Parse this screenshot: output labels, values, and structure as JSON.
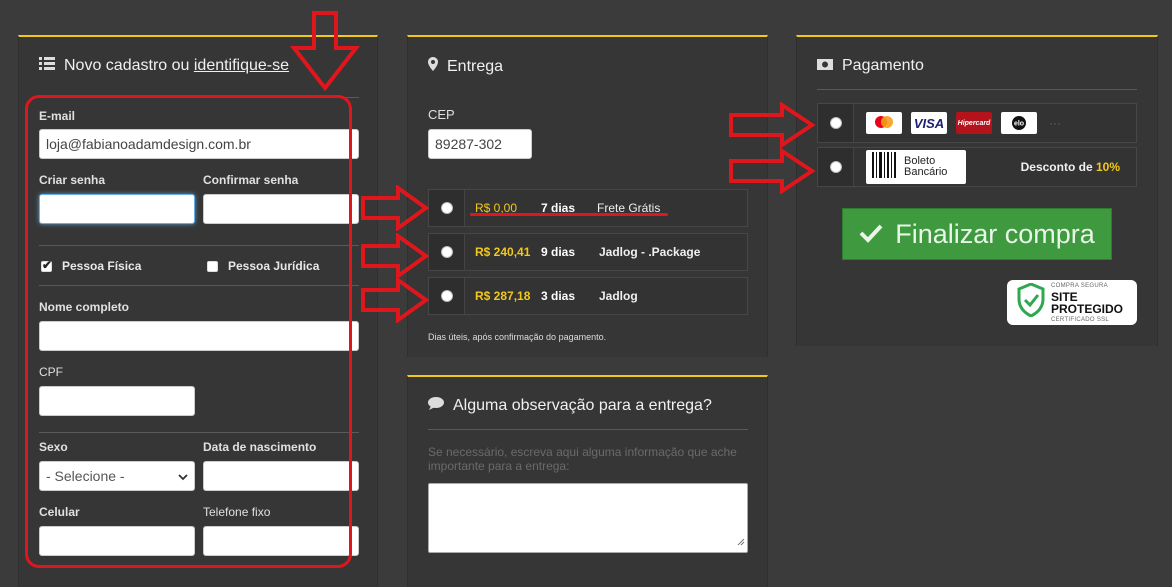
{
  "cadastro": {
    "title_prefix": "Novo cadastro ou ",
    "title_link": "identifique-se",
    "email_label": "E-mail",
    "email_value": "loja@fabianoadamdesign.com.br",
    "senha_label": "Criar senha",
    "confirmar_label": "Confirmar senha",
    "pessoa_fisica": "Pessoa Física",
    "pessoa_juridica": "Pessoa Jurídica",
    "nome_label": "Nome completo",
    "cpf_label": "CPF",
    "sexo_label": "Sexo",
    "sexo_value": "- Selecione -",
    "nascimento_label": "Data de nascimento",
    "celular_label": "Celular",
    "telefone_label": "Telefone fixo"
  },
  "entrega": {
    "title": "Entrega",
    "cep_label": "CEP",
    "cep_value": "89287-302",
    "options": [
      {
        "price": "R$ 0,00",
        "days": "7 dias",
        "carrier": "Frete Grátis"
      },
      {
        "price": "R$ 240,41",
        "days": "9 dias",
        "carrier": "Jadlog - .Package"
      },
      {
        "price": "R$ 287,18",
        "days": "3 dias",
        "carrier": "Jadlog"
      }
    ],
    "note": "Dias úteis, após confirmação do pagamento."
  },
  "observacao": {
    "title": "Alguma observação para a entrega?",
    "hint": "Se necessário, escreva aqui alguma informação que ache importante para a entrega:"
  },
  "pagamento": {
    "title": "Pagamento",
    "cards": [
      "mastercard",
      "VISA",
      "Hipercard",
      "elo"
    ],
    "boleto_line1": "Boleto",
    "boleto_line2": "Bancário",
    "desconto_prefix": "Desconto de ",
    "desconto_value": "10%",
    "finalizar": "Finalizar compra",
    "ssl_small_top": "COMPRA SEGURA",
    "ssl_big": "SITE PROTEGIDO",
    "ssl_small_bottom": "CERTIFICADO SSL"
  },
  "colors": {
    "accent": "#f2c919",
    "highlight": "#e0161d",
    "button": "#3f9a3f"
  }
}
